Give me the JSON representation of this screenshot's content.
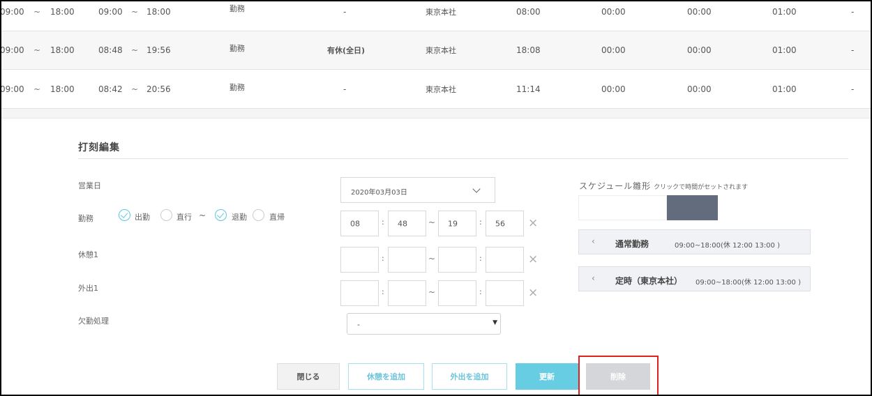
{
  "rows": [
    {
      "sched_start": "09:00",
      "sched_end": "18:00",
      "act_start": "09:00",
      "act_end": "18:00",
      "type": "勤務",
      "leave": "-",
      "office": "東京本社",
      "hours": "08:00",
      "c1": "00:00",
      "c2": "00:00",
      "c3": "01:00",
      "c4": "-"
    },
    {
      "sched_start": "09:00",
      "sched_end": "18:00",
      "act_start": "08:48",
      "act_end": "19:56",
      "type": "勤務",
      "leave": "有休(全日)",
      "office": "東京本社",
      "hours": "18:08",
      "c1": "00:00",
      "c2": "00:00",
      "c3": "01:00",
      "c4": "-"
    },
    {
      "sched_start": "09:00",
      "sched_end": "18:00",
      "act_start": "08:42",
      "act_end": "20:56",
      "type": "勤務",
      "leave": "-",
      "office": "東京本社",
      "hours": "11:14",
      "c1": "00:00",
      "c2": "00:00",
      "c3": "01:00",
      "c4": "-"
    }
  ],
  "tilde": "~",
  "panel": {
    "title": "打刻編集",
    "business_day_label": "営業日",
    "business_day_value": "2020年03月03日",
    "work_label": "勤務",
    "options": {
      "clock_in": "出勤",
      "direct_go": "直行",
      "clock_out": "退勤",
      "direct_return": "直帰"
    },
    "work_times": {
      "start_h": "08",
      "start_m": "48",
      "end_h": "19",
      "end_m": "56"
    },
    "break_label": "休憩1",
    "out_label": "外出1",
    "absence_label": "欠勤処理",
    "absence_value": "-",
    "colon": ":",
    "clear": "×"
  },
  "schedule": {
    "title": "スケジュール雛形",
    "hint": "クリックで時間がセットされます",
    "templates": [
      {
        "icon": "‹",
        "name": "通常勤務",
        "time": "09:00~18:00(休 12:00 13:00 )"
      },
      {
        "icon": "‹",
        "name": "定時（東京本社）",
        "time": "09:00~18:00(休 12:00 13:00 )"
      }
    ],
    "swatch_color": "#636c7d"
  },
  "buttons": {
    "close": "閉じる",
    "add_break": "休憩を追加",
    "add_out": "外出を追加",
    "update": "更新",
    "delete": "削除"
  },
  "colors": {
    "accent": "#66cde3",
    "highlight": "#e02020"
  }
}
